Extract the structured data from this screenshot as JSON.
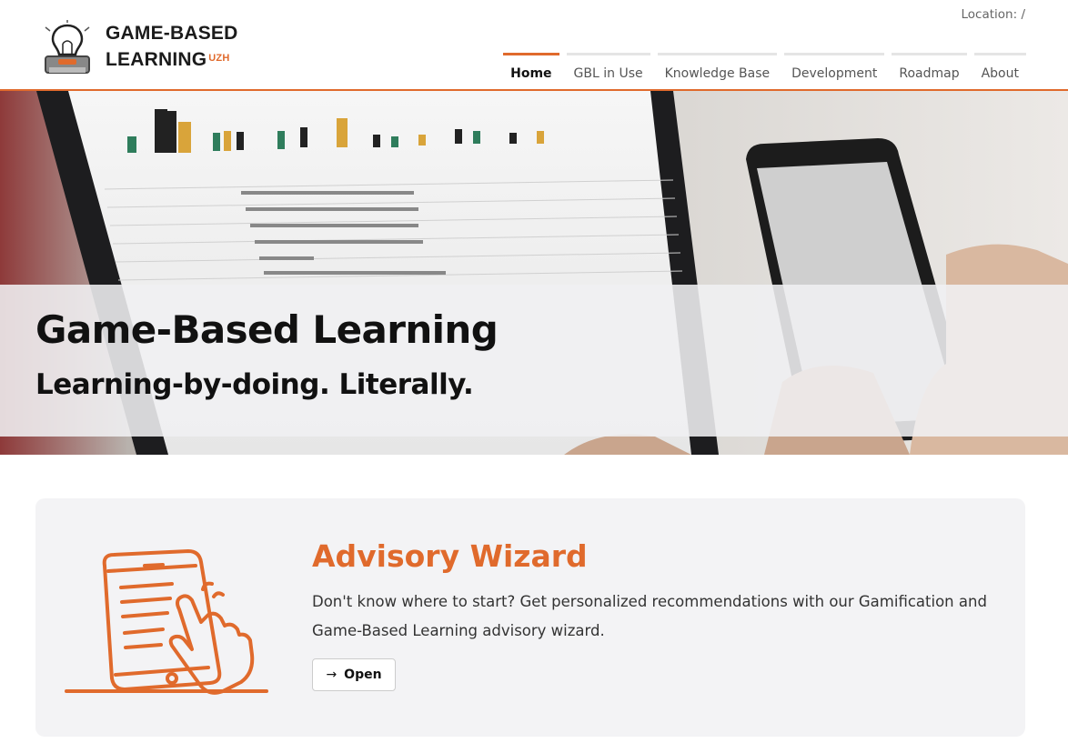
{
  "header": {
    "logo_line1": "GAME-BASED",
    "logo_line2": "LEARNING",
    "logo_sup": "UZH",
    "location": "Location: /",
    "nav": [
      "Home",
      "GBL in Use",
      "Knowledge Base",
      "Development",
      "Roadmap",
      "About"
    ]
  },
  "hero": {
    "title": "Game-Based Learning",
    "subtitle": "Learning-by-doing. Literally."
  },
  "card": {
    "title": "Advisory Wizard",
    "description": "Don't know where to start? Get personalized recommendations with our Gamification and Game-Based Learning advisory wizard.",
    "button_label": "Open",
    "button_icon": "arrow-right-icon"
  },
  "colors": {
    "accent": "#e06a2c"
  }
}
